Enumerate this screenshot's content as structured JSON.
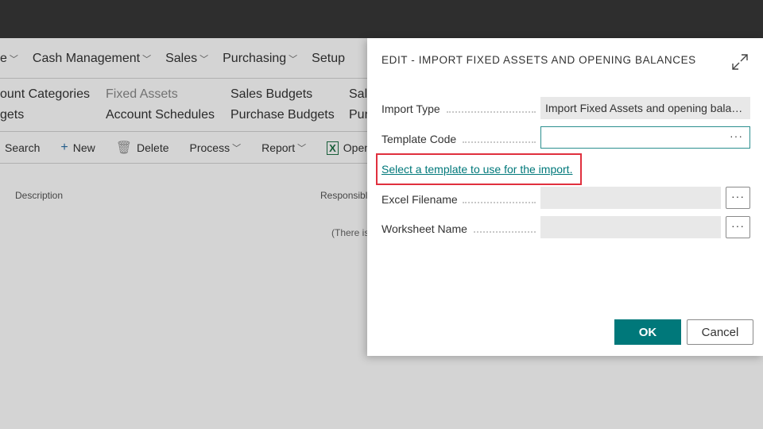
{
  "background": {
    "nav": [
      {
        "label": "e"
      },
      {
        "label": "Cash Management"
      },
      {
        "label": "Sales"
      },
      {
        "label": "Purchasing"
      },
      {
        "label": "Setup"
      }
    ],
    "sub_items": {
      "col1_row1": "ount Categories",
      "col1_row2": "gets",
      "col2_row1": "Fixed Assets",
      "col2_row2": "Account Schedules",
      "col3_row1": "Sales Budgets",
      "col3_row2": "Purchase Budgets",
      "col4_row1": "Sal",
      "col4_row2": "Pur"
    },
    "actions": {
      "search": "Search",
      "new": "New",
      "delete": "Delete",
      "process": "Process",
      "report": "Report",
      "open": "Open"
    },
    "columns": {
      "description": "Description",
      "responsible": "Responsibl"
    },
    "empty_text": "(There is"
  },
  "dialog": {
    "title": "EDIT - IMPORT FIXED ASSETS AND OPENING BALANCES",
    "fields": {
      "import_type_label": "Import Type",
      "import_type_value": "Import Fixed Assets and opening balances",
      "template_code_label": "Template Code",
      "template_code_value": "",
      "excel_filename_label": "Excel Filename",
      "excel_filename_value": "",
      "worksheet_name_label": "Worksheet Name",
      "worksheet_name_value": ""
    },
    "ellipsis": "···",
    "help_link": "Select a template to use for the import.",
    "ok_label": "OK",
    "cancel_label": "Cancel"
  },
  "colors": {
    "accent": "#00787a",
    "highlight": "#e0303e",
    "topbar": "#2e2e2e"
  }
}
